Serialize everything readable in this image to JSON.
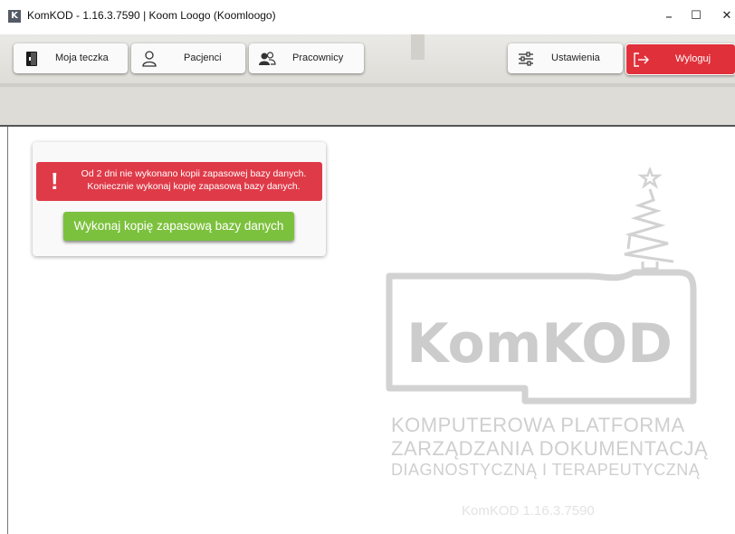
{
  "window": {
    "app_icon_letter": "K",
    "title": "KomKOD - 1.16.3.7590 | Koom Loogo (Koomloogo)",
    "minimize": "–",
    "maximize": "☐",
    "close": "✕"
  },
  "toolbar": {
    "my_folder": "Moja teczka",
    "patients": "Pacjenci",
    "employees": "Pracownicy",
    "settings": "Ustawienia",
    "logout": "Wyloguj"
  },
  "backup_panel": {
    "alert_line1": "Od 2 dni nie wykonano kopii zapasowej bazy danych.",
    "alert_line2": "Koniecznie wykonaj kopię zapasową bazy danych.",
    "action_button": "Wykonaj kopię zapasową bazy danych"
  },
  "watermark": {
    "logo_text": "KomKOD",
    "line1": "KOMPUTEROWA  PLATFORMA",
    "line2": "ZARZĄDZANIA DOKUMENTACJĄ",
    "line3": "DIAGNOSTYCZNĄ  I  TERAPEUTYCZNĄ",
    "version": "KomKOD  1.16.3.7590"
  },
  "colors": {
    "logout_red": "#e0303a",
    "alert_red": "#df3a48",
    "action_green": "#7cc13d",
    "watermark_gray": "#cfcfcf"
  }
}
